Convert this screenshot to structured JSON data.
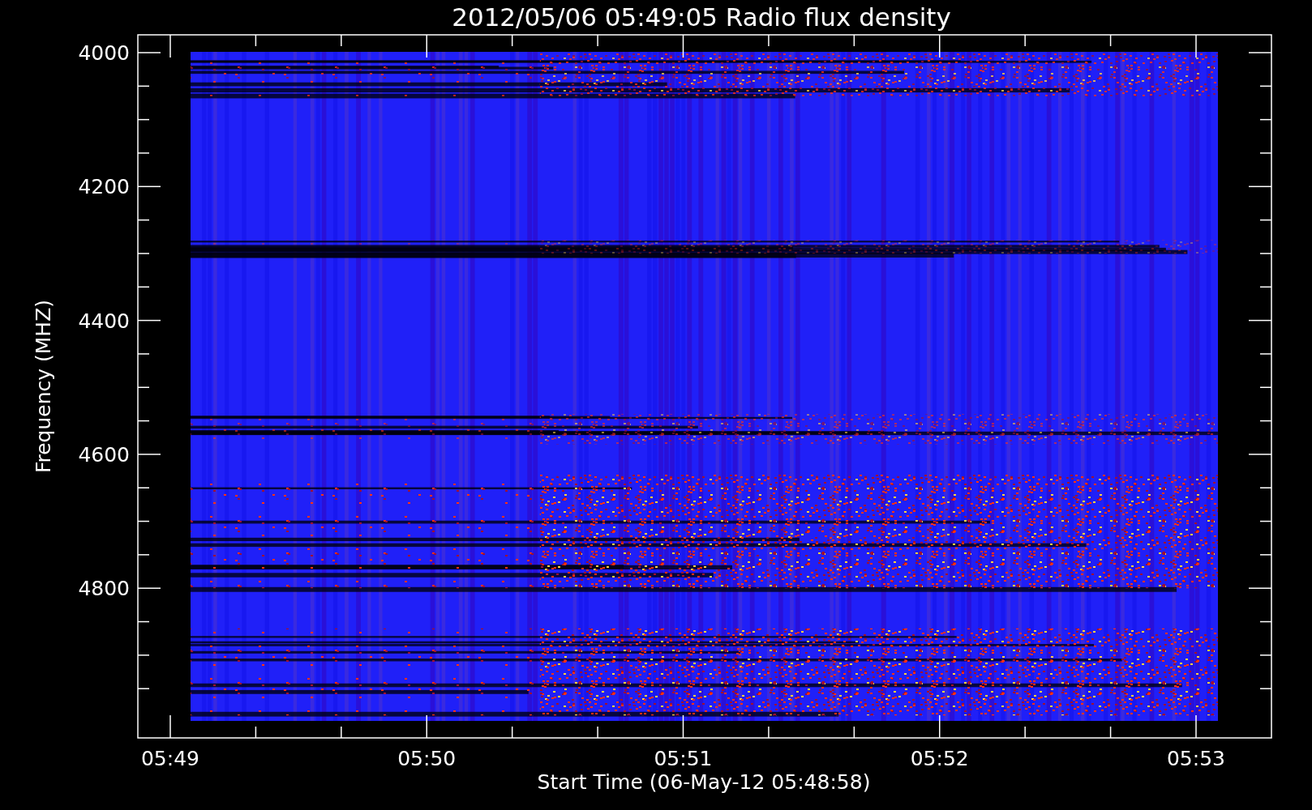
{
  "title": "2012/05/06 05:49:05 Radio flux density",
  "ylabel": "Frequency (MHZ)",
  "xlabel": "Start Time (06-May-12 05:48:58)",
  "yticks": [
    "4000",
    "4200",
    "4400",
    "4600",
    "4800"
  ],
  "xticks": [
    "05:49",
    "05:50",
    "05:51",
    "05:52",
    "05:53"
  ]
}
